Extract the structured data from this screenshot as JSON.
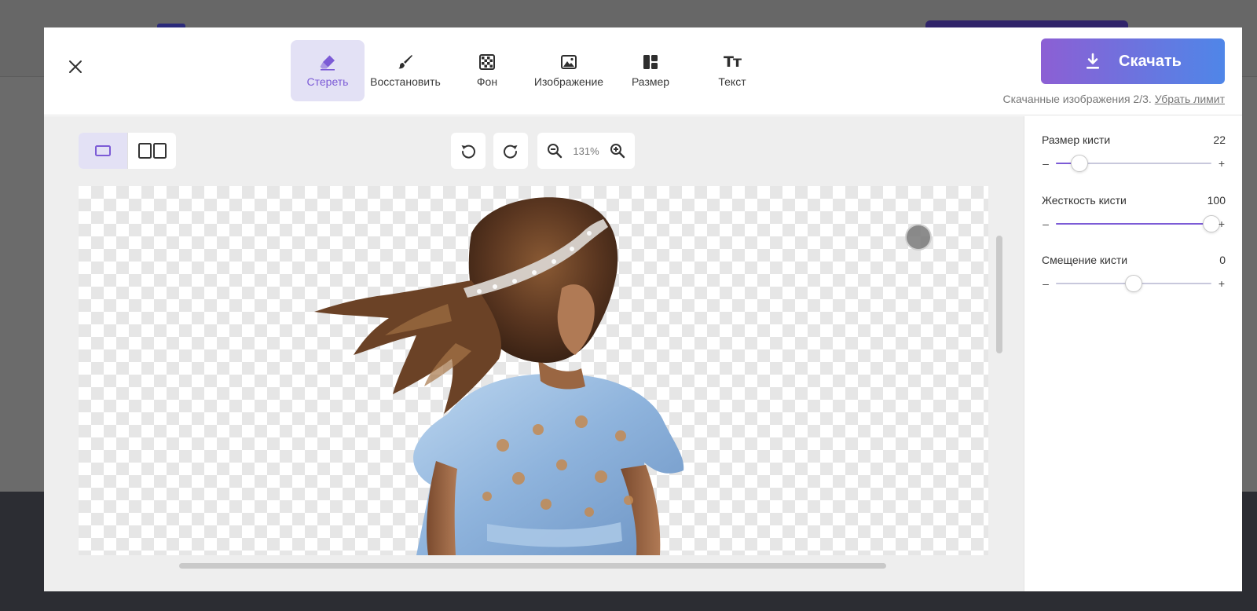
{
  "toolbar": {
    "tools": [
      {
        "label": "Стереть",
        "icon": "eraser-icon",
        "active": true
      },
      {
        "label": "Восстановить",
        "icon": "brush-icon",
        "active": false
      },
      {
        "label": "Фон",
        "icon": "checkerboard-icon",
        "active": false
      },
      {
        "label": "Изображение",
        "icon": "image-icon",
        "active": false
      },
      {
        "label": "Размер",
        "icon": "layout-icon",
        "active": false
      },
      {
        "label": "Текст",
        "icon": "text-icon",
        "active": false
      }
    ],
    "text_icon_glyph": "Тт"
  },
  "download": {
    "label": "Скачать",
    "note": "Скачанные изображения 2/3.",
    "limit_link": "Убрать лимит"
  },
  "workspace": {
    "zoom": "131%",
    "view_mode": "single"
  },
  "brush": {
    "size": {
      "label": "Размер кисти",
      "value": "22",
      "level": 0.15
    },
    "hardness": {
      "label": "Жесткость кисти",
      "value": "100",
      "level": 1.0
    },
    "offset": {
      "label": "Смещение кисти",
      "value": "0",
      "level": 0.5
    },
    "minus": "–",
    "plus": "+"
  },
  "colors": {
    "accent": "#7c5bd6",
    "download_gradient": [
      "#8c5fd4",
      "#4f86e8"
    ]
  }
}
